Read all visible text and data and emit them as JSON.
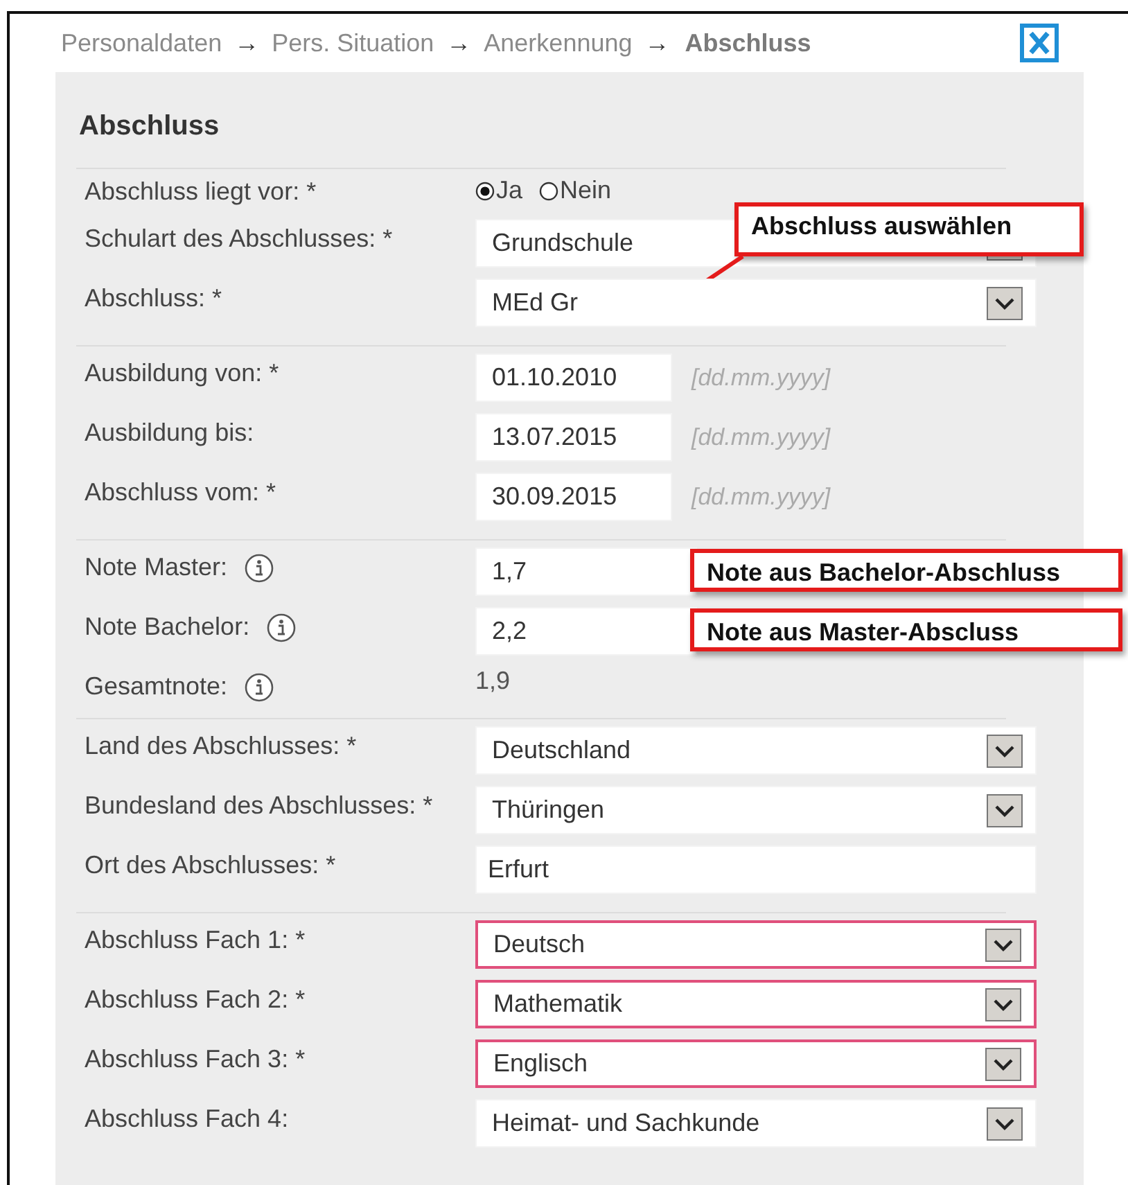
{
  "breadcrumb": [
    {
      "label": "Personaldaten",
      "separator": "→",
      "selected": false
    },
    {
      "label": "Pers. Situation",
      "separator": "→",
      "selected": false
    },
    {
      "label": "Anerkennung",
      "separator": "→",
      "selected": false
    },
    {
      "label": "Abschluss",
      "selected": true
    }
  ],
  "heading": "Abschluss",
  "sections": [
    {
      "fields": [
        {
          "label": "Abschluss liegt vor: *",
          "kind": "radio",
          "invalid": false,
          "options": [
            {
              "label": "Ja",
              "selected": true
            },
            {
              "label": "Nein",
              "selected": false
            }
          ]
        },
        {
          "label": "Schulart des Abschlusses: *",
          "kind": "select",
          "invalid": false,
          "value": "Grundschule",
          "callout": {
            "text": "Abschluss auswählen",
            "arrow": true
          }
        },
        {
          "label": "Abschluss: *",
          "kind": "select",
          "invalid": false,
          "value": "MEd Gr"
        }
      ]
    },
    {
      "fields": [
        {
          "label": "Ausbildung von: *",
          "kind": "date",
          "invalid": false,
          "value": "01.10.2010",
          "hint": "[dd.mm.yyyy]"
        },
        {
          "label": "Ausbildung bis:",
          "kind": "date",
          "invalid": false,
          "value": "13.07.2015",
          "hint": "[dd.mm.yyyy]"
        },
        {
          "label": "Abschluss vom: *",
          "kind": "date",
          "invalid": false,
          "value": "30.09.2015",
          "hint": "[dd.mm.yyyy]"
        }
      ]
    },
    {
      "fields": [
        {
          "label": "Note Master:",
          "kind": "grade",
          "invalid": false,
          "info": true,
          "value": "1,7",
          "callout": {
            "text": "Note aus Bachelor-Abschluss",
            "arrow": false
          }
        },
        {
          "label": "Note Bachelor:",
          "kind": "grade",
          "invalid": false,
          "info": true,
          "value": "2,2",
          "callout": {
            "text": "Note aus Master-Abscluss",
            "arrow": false
          }
        },
        {
          "label": "Gesamtnote:",
          "kind": "static",
          "invalid": false,
          "info": true,
          "value": "1,9"
        }
      ]
    },
    {
      "fields": [
        {
          "label": "Land des Abschlusses: *",
          "kind": "select",
          "invalid": false,
          "value": "Deutschland"
        },
        {
          "label": "Bundesland des Abschlusses: *",
          "kind": "select",
          "invalid": false,
          "value": "Thüringen"
        },
        {
          "label": "Ort des Abschlusses: *",
          "kind": "text",
          "invalid": false,
          "value": "Erfurt"
        }
      ]
    },
    {
      "fields": [
        {
          "label": "Abschluss Fach 1: *",
          "kind": "select",
          "invalid": true,
          "value": "Deutsch"
        },
        {
          "label": "Abschluss Fach 2: *",
          "kind": "select",
          "invalid": true,
          "value": "Mathematik"
        },
        {
          "label": "Abschluss Fach 3: *",
          "kind": "select",
          "invalid": true,
          "value": "Englisch"
        },
        {
          "label": "Abschluss Fach 4:",
          "kind": "select",
          "invalid": false,
          "value": "Heimat- und Sachkunde"
        }
      ]
    }
  ]
}
